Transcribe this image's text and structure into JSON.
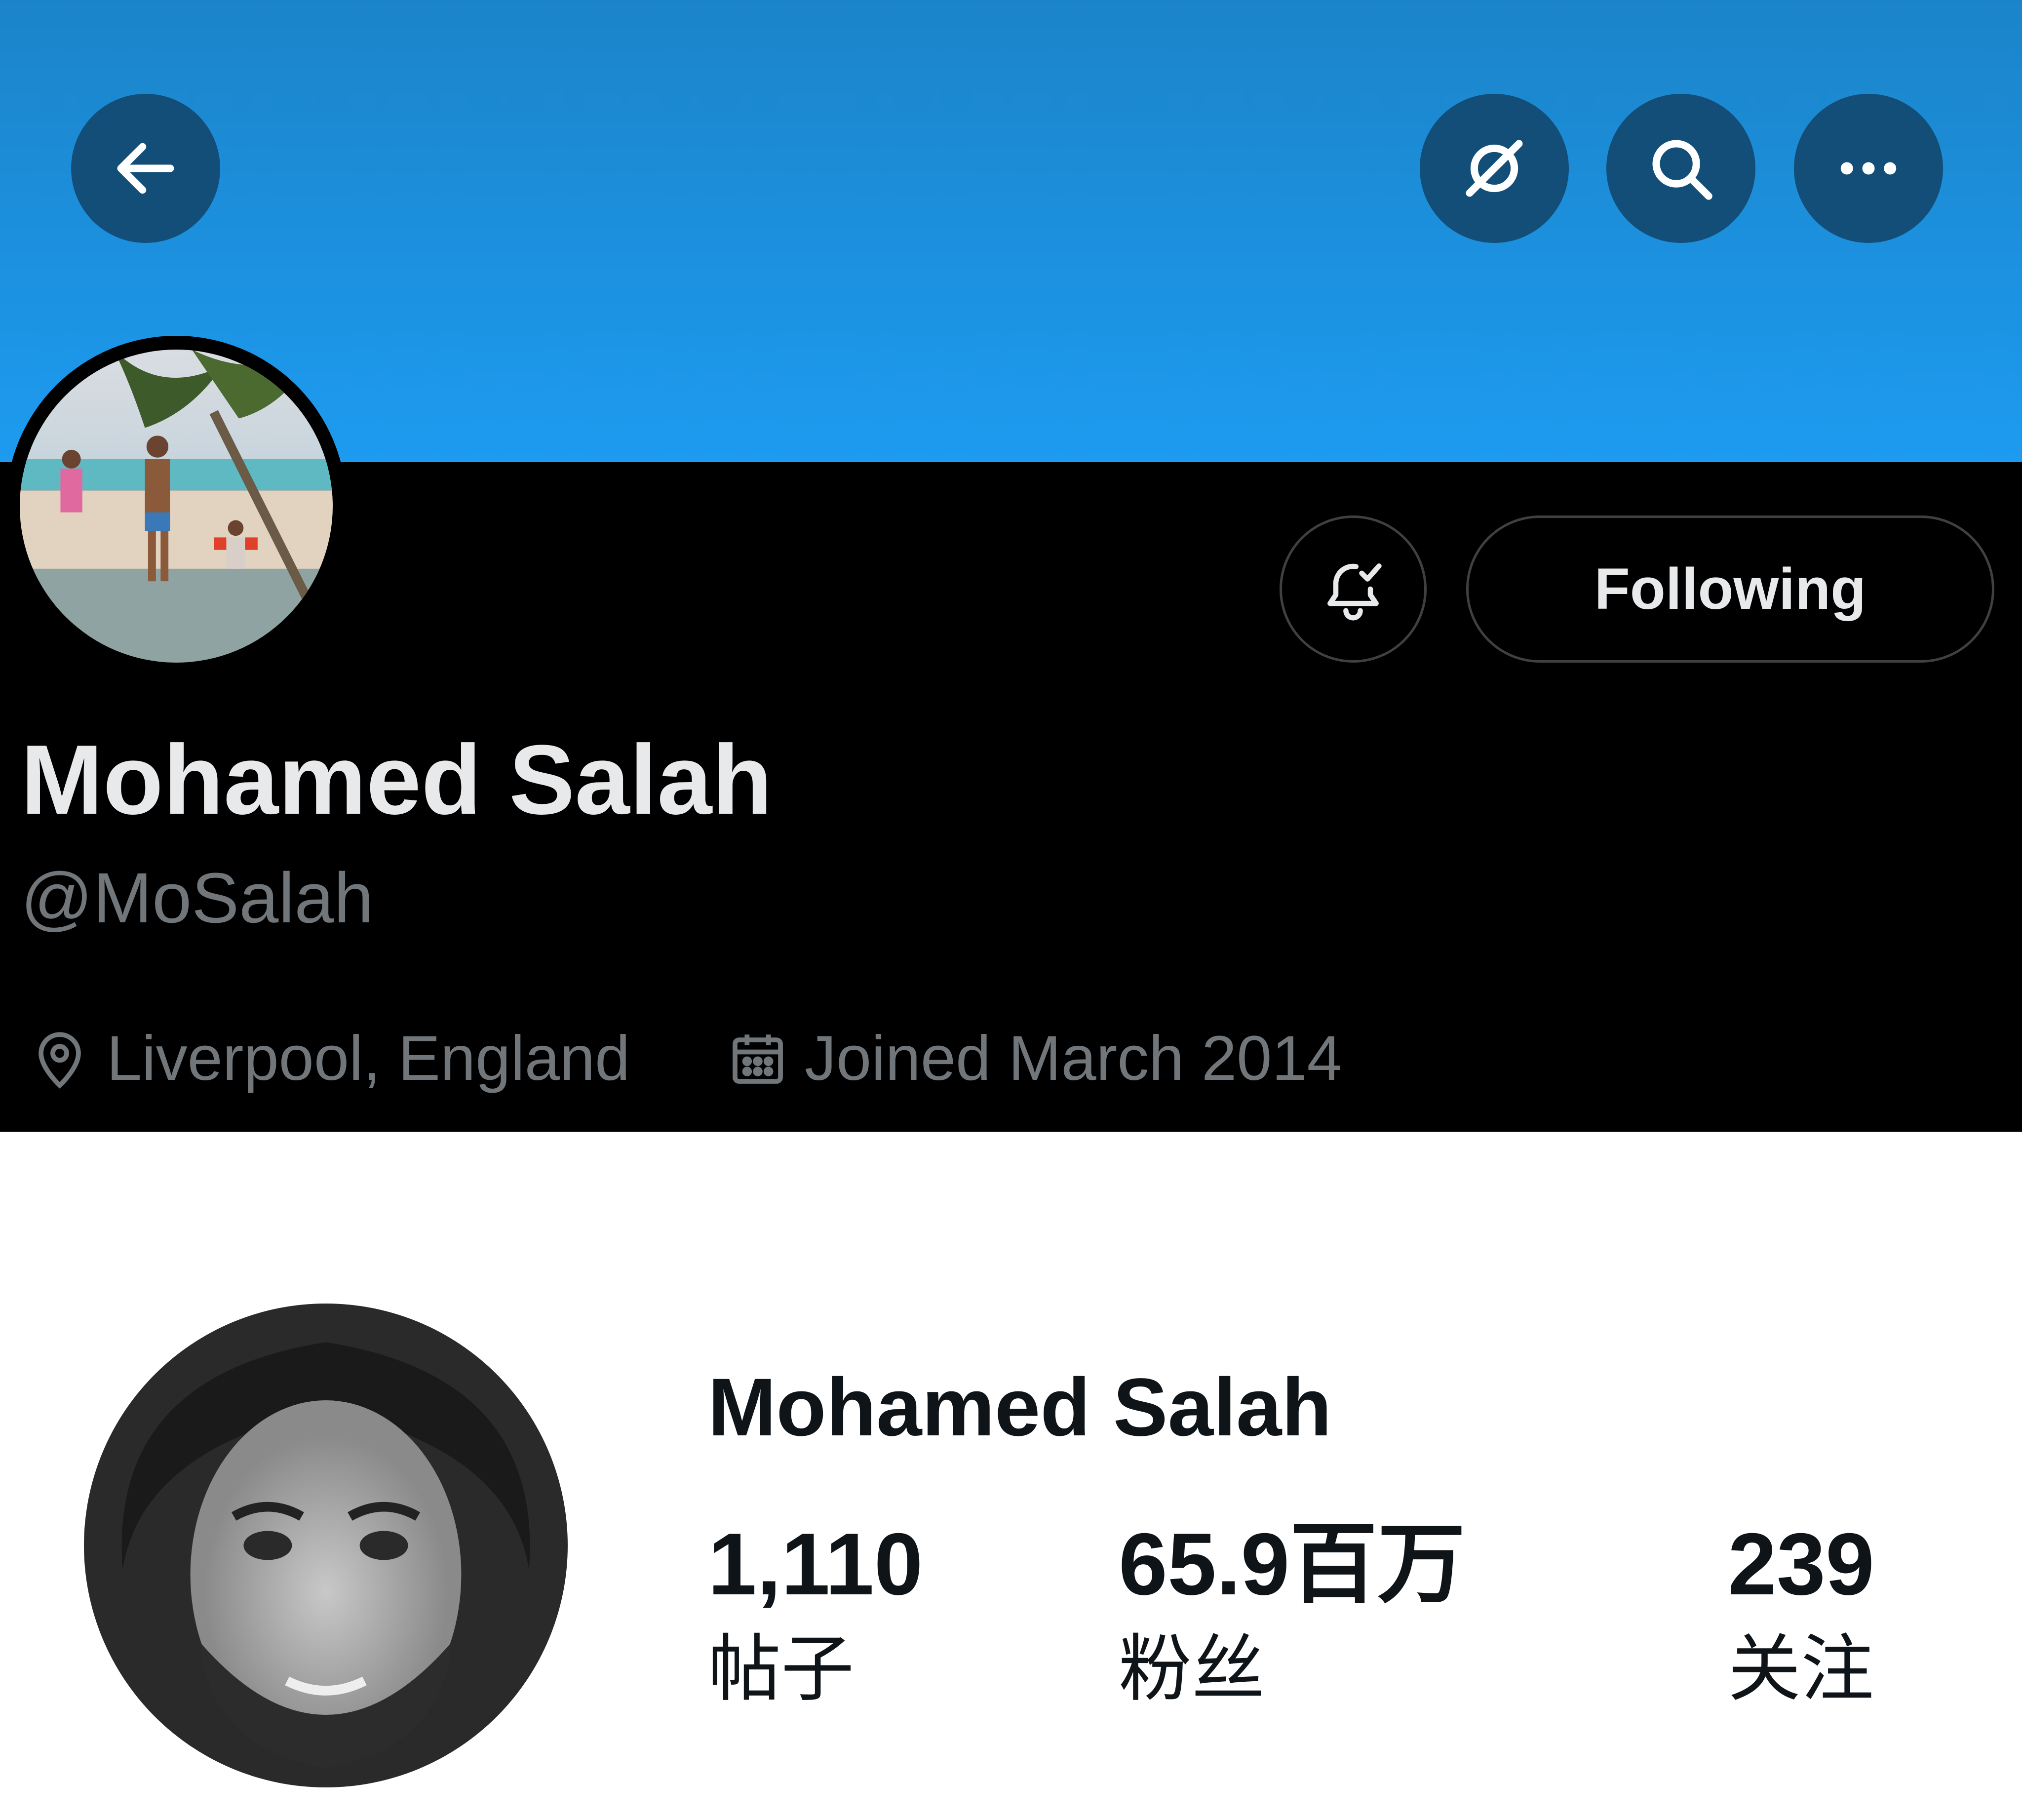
{
  "profile": {
    "display_name": "Mohamed Salah",
    "handle": "@MoSalah",
    "location": "Liverpool, England",
    "joined": "Joined March 2014"
  },
  "header": {
    "icons": [
      "back-arrow-icon",
      "grok-icon",
      "search-icon",
      "more-icon"
    ]
  },
  "actions": {
    "following_label": "Following",
    "notification_icon": "bell-check-icon"
  },
  "card": {
    "name": "Mohamed Salah",
    "stats": [
      {
        "value": "1,110",
        "label": "帖子"
      },
      {
        "value": "65.9百万",
        "label": "粉丝"
      },
      {
        "value": "239",
        "label": "关注"
      }
    ]
  },
  "colors": {
    "banner": "#1d9bf0",
    "header_button": "#124e78",
    "profile_bg": "#000000",
    "name_text": "#e7e9ea",
    "secondary_text": "#71767b"
  }
}
